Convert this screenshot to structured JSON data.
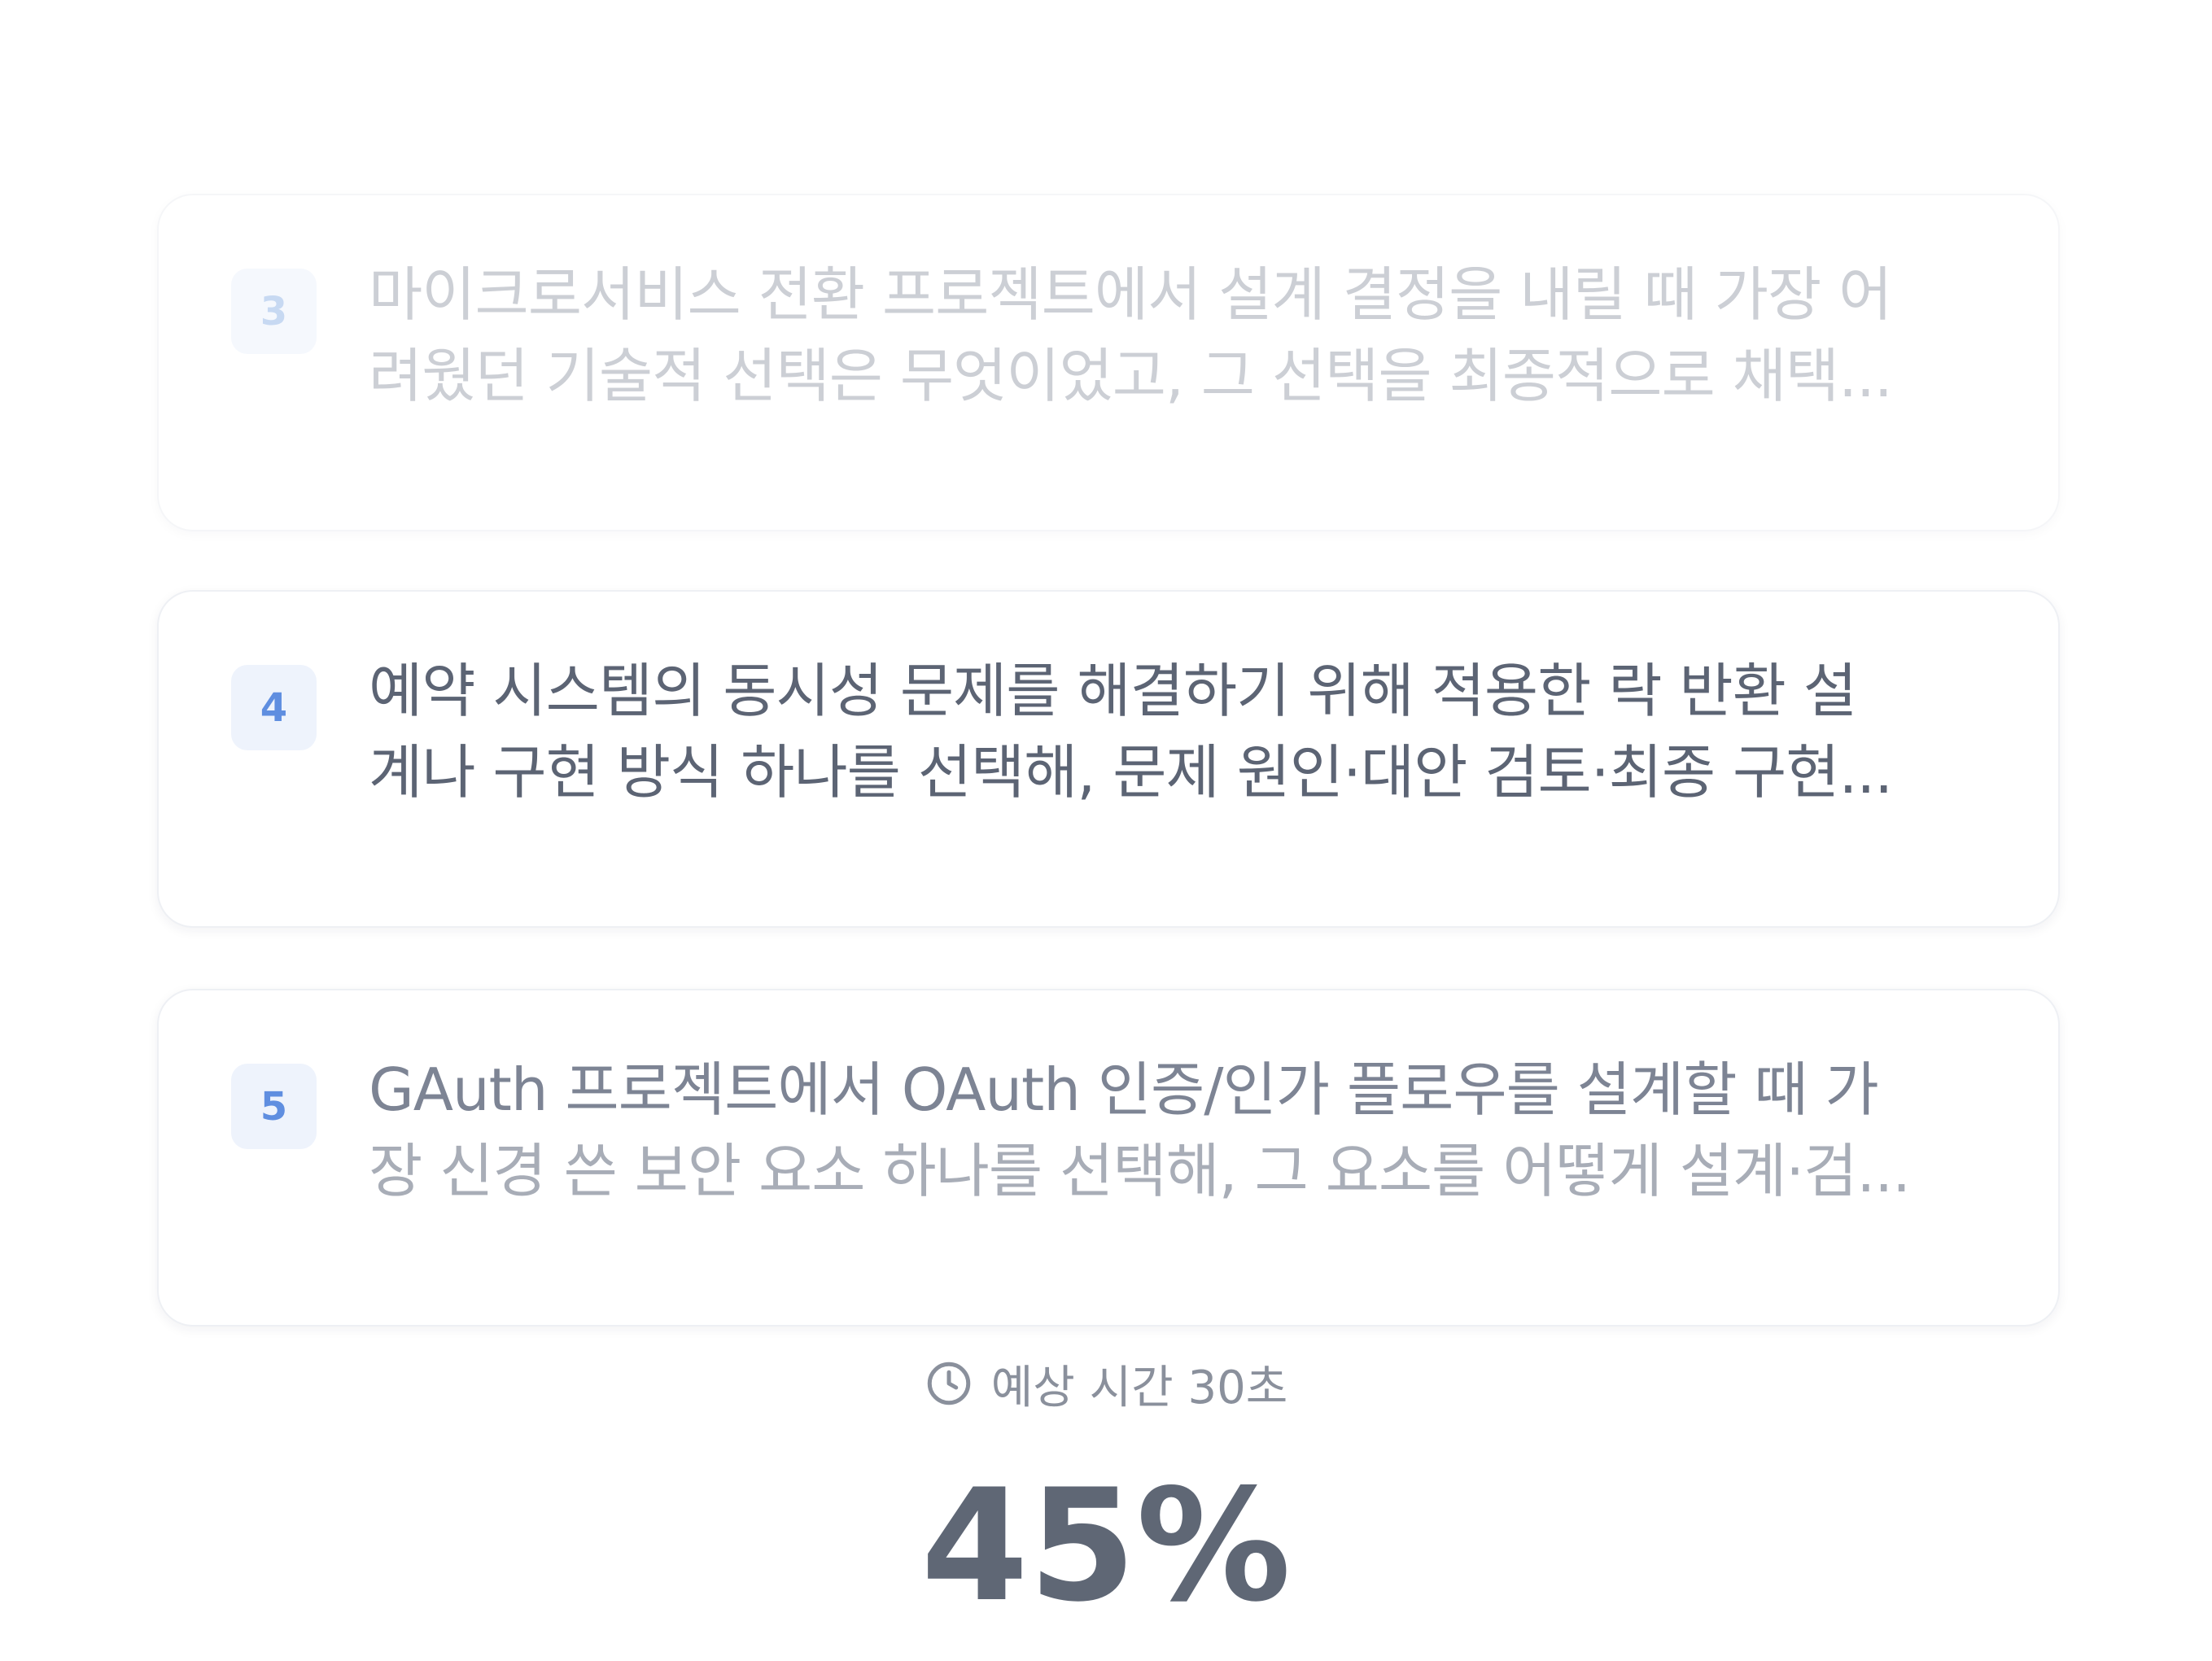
{
  "questions": [
    {
      "number": "3",
      "line1": "마이크로서비스 전환 프로젝트에서 설계 결정을 내릴 때 가장 어",
      "line2": "려웠던 기술적 선택은 무엇이었고, 그 선택을 최종적으로 채택..."
    },
    {
      "number": "4",
      "line1": "예약 시스템의 동시성 문제를 해결하기 위해 적용한 락 반환 설",
      "line2": "계나 구현 방식 하나를 선택해, 문제 원인·대안 검토·최종 구현..."
    },
    {
      "number": "5",
      "line1": "GAuth 프로젝트에서 OAuth 인증/인가 플로우를 설계할 때 가",
      "line2": "장 신경 쓴 보안 요소 하나를 선택해, 그 요소를 어떻게 설계·검..."
    }
  ],
  "estimate": {
    "icon": "clock-icon",
    "label": "예상 시간 30초"
  },
  "progress": {
    "label": "45%",
    "value": 45
  }
}
